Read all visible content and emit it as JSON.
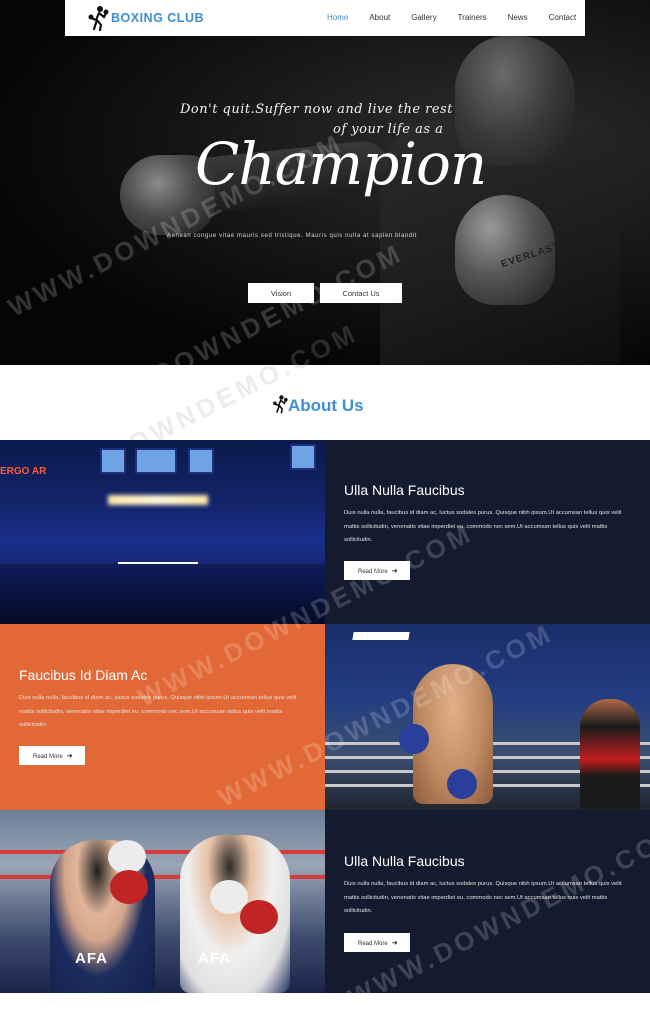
{
  "nav": {
    "brand": "BOXING CLUB",
    "items": [
      {
        "label": "Home",
        "active": true
      },
      {
        "label": "About",
        "active": false
      },
      {
        "label": "Gallery",
        "active": false
      },
      {
        "label": "Trainers",
        "active": false
      },
      {
        "label": "News",
        "active": false
      },
      {
        "label": "Contact",
        "active": false
      }
    ]
  },
  "hero": {
    "slogan_line1": "Don't quit.Suffer now and live the rest",
    "slogan_line2": "of your life as a",
    "headline": "Champion",
    "tagline": "Aenean congue vitae mauris sed tristique. Mauris quis nulla at sapien blandit",
    "glove_brand": "EVERLAST",
    "buttons": {
      "vision": "Vision",
      "contact": "Contact Us"
    }
  },
  "about": {
    "title": "About Us",
    "panels": [
      {
        "heading": "Ulla Nulla Faucibus",
        "body": "Duis nulla nulla, faucibus id diam ac, luctus sodales purus. Quisque nibh ipsum.Ut accumsan tellus quis velit mattis sollicitudin, venenatis vitae imperdiet eu, commodo nec sem.Ut accumsan tellus quis velit mattis sollicitudin.",
        "button": "Read More"
      },
      {
        "heading": "Faucibus Id Diam Ac",
        "body": "Duis nulla nulla, faucibus id diam ac, luctus sodales purus. Quisque nibh ipsum.Ut accumsan tellus quis velit mattis sollicitudin, venenatis vitae imperdiet eu, commodo nec sem.Ut accumsan tellus quis velit mattis sollicitudin.",
        "button": "Read More"
      },
      {
        "heading": "Ulla Nulla Faucibus",
        "body": "Duis nulla nulla, faucibus id diam ac, luctus sodales purus. Quisque nibh ipsum.Ut accumsan tellus quis velit mattis sollicitudin, venenatis vitae imperdiet eu, commodo nec sem.Ut accumsan tellus quis velit mattis sollicitudin.",
        "button": "Read More"
      }
    ]
  },
  "images": {
    "arena_sign": "ERGO AR",
    "trunk_text_1": "AFA",
    "trunk_text_2": "AFA"
  },
  "watermark": "WWW.DOWNDEMO.COM",
  "colors": {
    "accent": "#3e8fd5",
    "dark_panel": "#151b2f",
    "orange_panel": "#e26937"
  }
}
